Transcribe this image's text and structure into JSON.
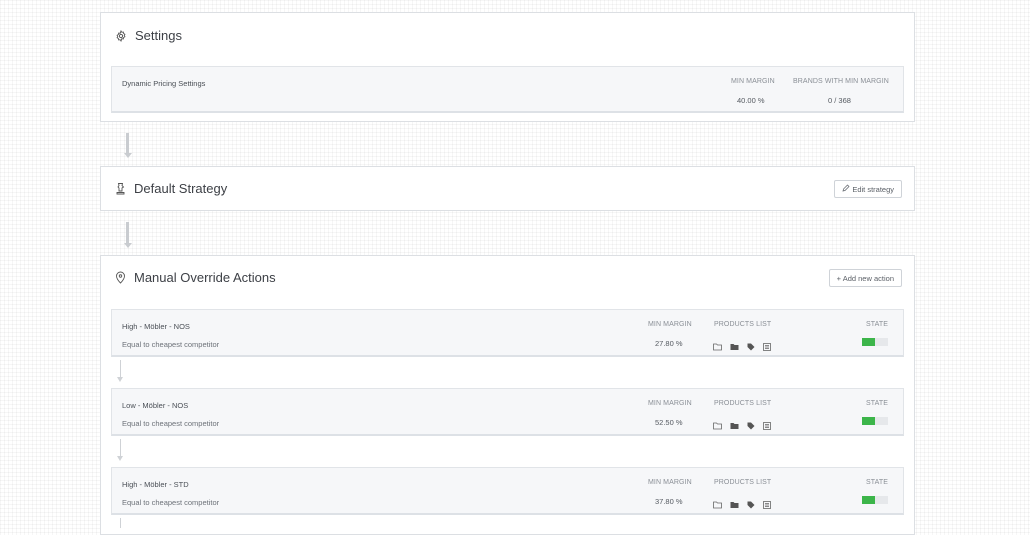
{
  "settings": {
    "title": "Settings",
    "icon": "gear-icon",
    "row": {
      "name": "Dynamic Pricing Settings",
      "min_margin_label": "MIN MARGIN",
      "min_margin_value": "40.00 %",
      "brands_label": "BRANDS WITH MIN MARGIN",
      "brands_value": "0 / 368"
    }
  },
  "default_strategy": {
    "title": "Default Strategy",
    "icon": "chess-icon",
    "edit_label": "Edit strategy"
  },
  "manual_override": {
    "title": "Manual Override Actions",
    "icon": "map-pin-icon",
    "add_label": "+ Add new action",
    "columns": {
      "min_margin": "MIN MARGIN",
      "products_list": "PRODUCTS LIST",
      "state": "STATE"
    },
    "actions": [
      {
        "name": "High - Möbler - NOS",
        "desc": "Equal to cheapest competitor",
        "min_margin": "27.80 %",
        "state_on": true
      },
      {
        "name": "Low - Möbler - NOS",
        "desc": "Equal to cheapest competitor",
        "min_margin": "52.50 %",
        "state_on": true
      },
      {
        "name": "High - Möbler - STD",
        "desc": "Equal to cheapest competitor",
        "min_margin": "37.80 %",
        "state_on": true
      }
    ]
  },
  "colors": {
    "toggle_on": "#3cb54a",
    "border": "#dcdfe3",
    "inner_bg": "#f6f7f9"
  }
}
